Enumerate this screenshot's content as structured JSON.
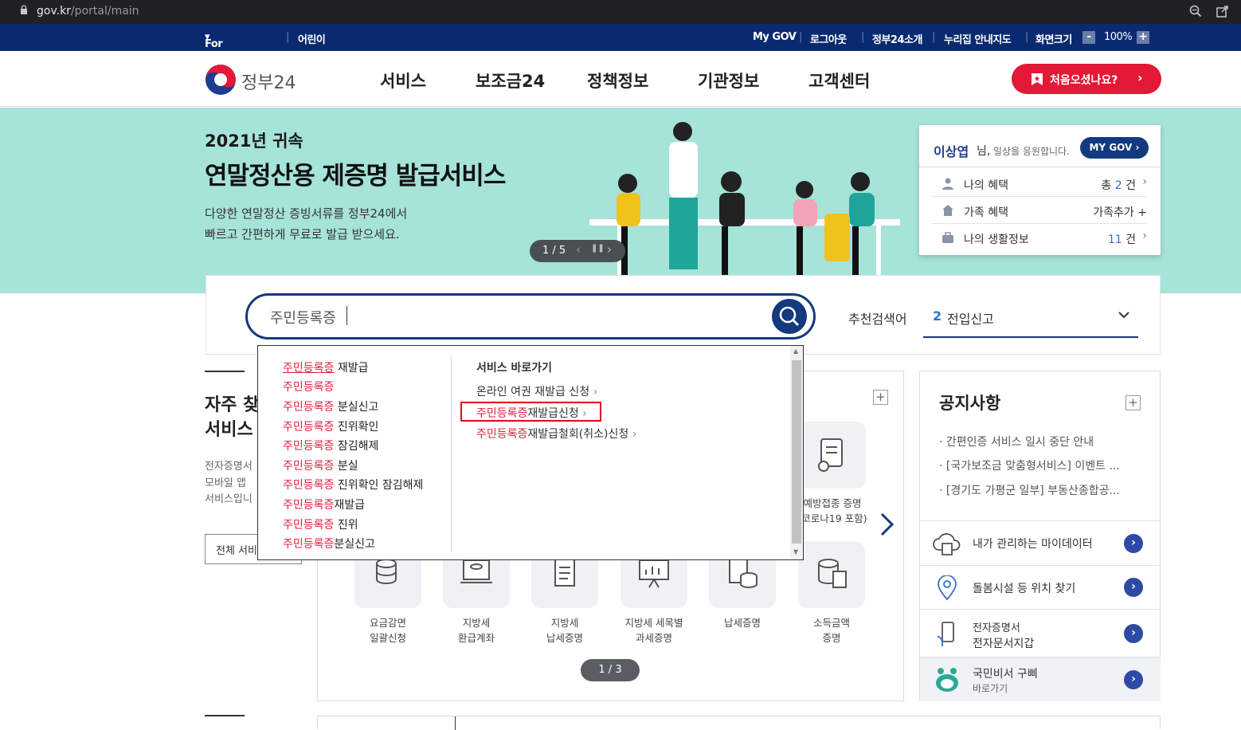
{
  "browser": {
    "url_host": "gov.kr",
    "url_path": "/portal/main"
  },
  "util_bar": {
    "foreigners": "For Foreigners",
    "kids": "어린이",
    "mygov": "My GOV",
    "logout": "로그아웃",
    "about": "정부24소개",
    "sitemap": "누리집 안내지도",
    "screen_size": "화면크기",
    "zoom": "100%",
    "zoom_minus": "-",
    "zoom_plus": "+"
  },
  "header": {
    "logo_text": "정부24",
    "nav": [
      "서비스",
      "보조금24",
      "정책정보",
      "기관정보",
      "고객센터"
    ],
    "first_visit": "처음오셨나요?"
  },
  "banner": {
    "year_title": "2021년 귀속",
    "headline": "연말정산용 제증명 발급서비스",
    "desc1": "다양한 연말정산 증빙서류를 정부24에서",
    "desc2": "빠르고 간편하게 무료로 발급 받으세요.",
    "pager": "1 / 5"
  },
  "my_card": {
    "user_name": "이상엽",
    "greeting_suffix": "님,",
    "greeting": "일상을 응원합니다.",
    "mygov_button": "MY GOV",
    "rows": [
      {
        "label": "나의 혜택",
        "value_prefix": "총 ",
        "value_num": "2",
        "value_suffix": " 건"
      },
      {
        "label": "가족 혜택",
        "value_prefix": "가족추가 ",
        "value_num": "",
        "value_suffix": "+"
      },
      {
        "label": "나의 생활정보",
        "value_prefix": "",
        "value_num": "11",
        "value_suffix": " 건"
      }
    ]
  },
  "search": {
    "query": "주민등록증",
    "recommend_label": "추천검색어",
    "recommend_rank": "2",
    "recommend_term": "전입신고"
  },
  "dropdown": {
    "suggestions": [
      {
        "hl": "주민등록증",
        "rest": " 재발급"
      },
      {
        "hl": "주민등록증",
        "rest": ""
      },
      {
        "hl": "주민등록증",
        "rest": " 분실신고"
      },
      {
        "hl": "주민등록증",
        "rest": " 진위확인"
      },
      {
        "hl": "주민등록증",
        "rest": " 잠김해제"
      },
      {
        "hl": "주민등록증",
        "rest": " 분실"
      },
      {
        "hl": "주민등록증",
        "rest": " 진위확인 잠김해제"
      },
      {
        "hl": "주민등록증",
        "rest": "재발급"
      },
      {
        "hl": "주민등록증",
        "rest": " 진위"
      },
      {
        "hl": "주민등록증",
        "rest": "분실신고"
      }
    ],
    "services_title": "서비스 바로가기",
    "services": [
      {
        "hl": "",
        "rest": "온라인 여권 재발급 신청"
      },
      {
        "hl": "주민등록증",
        "rest": "재발급신청"
      },
      {
        "hl": "주민등록증",
        "rest": "재발급철회(취소)신청"
      }
    ]
  },
  "frequent": {
    "title_line1": "자주 찾",
    "title_line2": "서비스",
    "desc1": "전자증명서",
    "desc2": "모바일 앱",
    "desc3": "서비스입니",
    "all_button": "전체 서비",
    "top_tile_label1": "예방접종 증명",
    "top_tile_label2": "(코로나19 포함)",
    "tiles": [
      {
        "l1": "요금감면",
        "l2": "일괄신청"
      },
      {
        "l1": "지방세",
        "l2": "환급계좌"
      },
      {
        "l1": "지방세",
        "l2": "납세증명"
      },
      {
        "l1": "지방세 세목별",
        "l2": "과세증명"
      },
      {
        "l1": "납세증명",
        "l2": ""
      },
      {
        "l1": "소득금액",
        "l2": "증명"
      }
    ],
    "pager": "1 / 3"
  },
  "notices": {
    "title": "공지사항",
    "items": [
      "간편인증 서비스 일시 중단 안내",
      "[국가보조금 맞춤형서비스] 이벤트 ...",
      "[경기도 가평군 일부] 부동산종합공..."
    ]
  },
  "quick_links": [
    {
      "l1": "내가 관리하는 마이데이터",
      "l2": ""
    },
    {
      "l1": "돌봄시설 등 위치 찾기",
      "l2": ""
    },
    {
      "l1": "전자증명서",
      "l2": "전자문서지갑"
    },
    {
      "l1": "국민비서 구삐",
      "l2": "바로가기"
    }
  ],
  "colors": {
    "navy": "#0a2a70",
    "teal": "#a6e3d8",
    "red": "#e31937",
    "highlight": "#e0203d",
    "search_border": "#13397e"
  }
}
